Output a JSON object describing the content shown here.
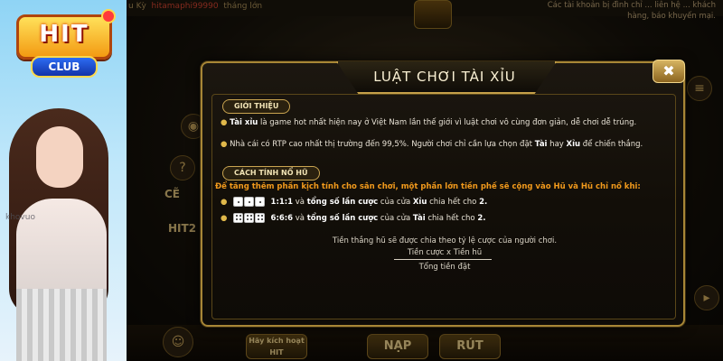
{
  "promo": {
    "logo_hit": "HIT",
    "logo_club": "CLUB",
    "watermark": "khovuo"
  },
  "game": {
    "top_text": "u Kỳ",
    "top_text_2": "tháng lớn",
    "top_notice": "Các tài khoản bị đình chỉ ... liên hệ ... khách hàng, báo khuyến mại.",
    "bg_labels": [
      "CẼ",
      "HIT2"
    ],
    "side_icons": [
      "question-icon",
      "chip-icon"
    ],
    "bottom": {
      "promo_label": "Hãy kích hoạt HIT",
      "nap_label": "NẠP",
      "rut_label": "RÚT"
    }
  },
  "modal": {
    "title": "LUẬT CHƠI TÀI XỈU",
    "close_label": "✖",
    "section_intro": "GIỚI THIỆU",
    "intro": [
      {
        "lead": "Tài xỉu",
        "text": " là game hot nhất hiện nay ở Việt Nam lần thế giới vì luật chơi vô cùng đơn giản, dễ chơi dễ trúng."
      },
      {
        "lead": "",
        "text": "Nhà cái có RTP cao nhất thị trường đến 99,5%. Người chơi chỉ cần lựa chọn đặt ",
        "b1": "Tài",
        "mid": " hay ",
        "b2": "Xỉu",
        "end": " để chiến thắng."
      }
    ],
    "section_jackpot": "CÁCH TÍNH NỔ HŨ",
    "jackpot_rule": "Để tăng thêm phần kịch tính cho sân chơi, một phần lớn tiền phế sẽ cộng vào Hũ và Hũ chỉ nổ khi:",
    "combos": [
      {
        "code": "1:1:1",
        "text1": " và ",
        "bold": "tổng số lần cược",
        "text2": " của cửa ",
        "side": "Xỉu",
        "text3": " chia hết cho ",
        "num": "2."
      },
      {
        "code": "6:6:6",
        "text1": " và ",
        "bold": "tổng số lần cược",
        "text2": " của cửa ",
        "side": "Tài",
        "text3": " chia hết cho ",
        "num": "2."
      }
    ],
    "formula_intro": "Tiền thắng hũ sẽ được chia theo tỷ lệ cược của người chơi.",
    "formula_top": "Tiền cược x Tiền hũ",
    "formula_bottom": "Tổng tiền đặt"
  }
}
